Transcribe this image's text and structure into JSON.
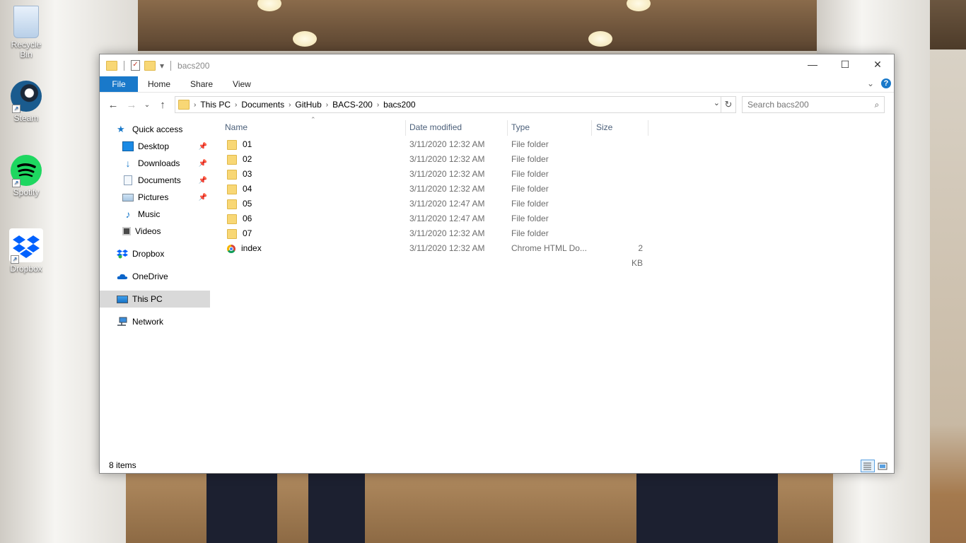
{
  "desktop": {
    "icons": [
      {
        "label": "Recycle Bin",
        "icon": "recycle-bin-icon"
      },
      {
        "label": "Steam",
        "icon": "steam-icon"
      },
      {
        "label": "Spotify",
        "icon": "spotify-icon"
      },
      {
        "label": "Dropbox",
        "icon": "dropbox-icon"
      }
    ]
  },
  "window": {
    "title": "bacs200",
    "controls": {
      "minimize": "—",
      "maximize": "☐",
      "close": "✕"
    }
  },
  "ribbon": {
    "tabs": [
      {
        "label": "File",
        "active": true
      },
      {
        "label": "Home"
      },
      {
        "label": "Share"
      },
      {
        "label": "View"
      }
    ],
    "help": "?"
  },
  "address": {
    "crumbs": [
      "This PC",
      "Documents",
      "GitHub",
      "BACS-200",
      "bacs200"
    ]
  },
  "search": {
    "placeholder": "Search bacs200"
  },
  "nav": {
    "items": [
      {
        "label": "Quick access",
        "icon": "star-icon"
      },
      {
        "label": "Desktop",
        "icon": "desktop-icon",
        "pinned": true
      },
      {
        "label": "Downloads",
        "icon": "download-arrow-icon",
        "pinned": true
      },
      {
        "label": "Documents",
        "icon": "document-icon",
        "pinned": true
      },
      {
        "label": "Pictures",
        "icon": "picture-icon",
        "pinned": true
      },
      {
        "label": "Music",
        "icon": "music-note-icon"
      },
      {
        "label": "Videos",
        "icon": "film-icon"
      },
      {
        "label": "Dropbox",
        "icon": "dropbox-icon"
      },
      {
        "label": "OneDrive",
        "icon": "cloud-icon"
      },
      {
        "label": "This PC",
        "icon": "computer-icon",
        "selected": true
      },
      {
        "label": "Network",
        "icon": "network-icon"
      }
    ]
  },
  "columns": {
    "name": "Name",
    "date": "Date modified",
    "type": "Type",
    "size": "Size"
  },
  "files": [
    {
      "name": "01",
      "date": "3/11/2020 12:32 AM",
      "type": "File folder",
      "size": ""
    },
    {
      "name": "02",
      "date": "3/11/2020 12:32 AM",
      "type": "File folder",
      "size": ""
    },
    {
      "name": "03",
      "date": "3/11/2020 12:32 AM",
      "type": "File folder",
      "size": ""
    },
    {
      "name": "04",
      "date": "3/11/2020 12:32 AM",
      "type": "File folder",
      "size": ""
    },
    {
      "name": "05",
      "date": "3/11/2020 12:47 AM",
      "type": "File folder",
      "size": ""
    },
    {
      "name": "06",
      "date": "3/11/2020 12:47 AM",
      "type": "File folder",
      "size": ""
    },
    {
      "name": "07",
      "date": "3/11/2020 12:32 AM",
      "type": "File folder",
      "size": ""
    },
    {
      "name": "index",
      "date": "3/11/2020 12:32 AM",
      "type": "Chrome HTML Do...",
      "size": "2 KB"
    }
  ],
  "status": {
    "count": "8 items"
  },
  "colors": {
    "accent": "#1979ca",
    "selected_nav": "#d9d9d9",
    "header_text": "#4c607a"
  }
}
